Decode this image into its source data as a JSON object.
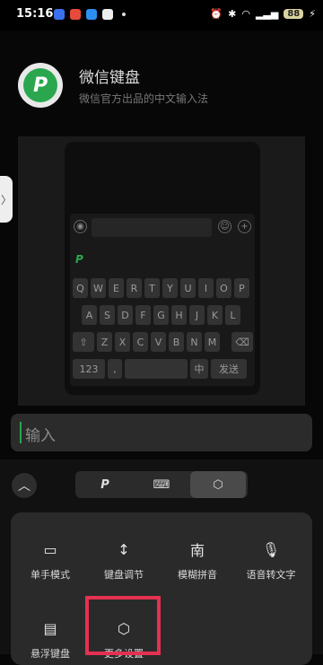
{
  "status": {
    "time": "15:16",
    "battery": "88"
  },
  "app": {
    "name": "微信键盘",
    "subtitle": "微信官方出品的中文输入法"
  },
  "preview": {
    "rows": [
      [
        "Q",
        "W",
        "E",
        "R",
        "T",
        "Y",
        "U",
        "I",
        "O",
        "P"
      ],
      [
        "A",
        "S",
        "D",
        "F",
        "G",
        "H",
        "J",
        "K",
        "L"
      ],
      [
        "Z",
        "X",
        "C",
        "V",
        "B",
        "N",
        "M"
      ]
    ],
    "num_key": "123",
    "comma_key": ",",
    "lang_key": "中",
    "send_key": "发送"
  },
  "input": {
    "placeholder": "输入"
  },
  "toolbar": {
    "tabs": [
      "logo-tab",
      "keyboard-tab",
      "settings-tab"
    ]
  },
  "settings_tiles": [
    {
      "label": "单手模式",
      "icon": "one-hand-icon"
    },
    {
      "label": "键盘调节",
      "icon": "resize-icon"
    },
    {
      "label": "模糊拼音",
      "icon": "fuzzy-pinyin-icon"
    },
    {
      "label": "语音转文字",
      "icon": "voice-to-text-icon"
    },
    {
      "label": "悬浮键盘",
      "icon": "floating-keyboard-icon"
    },
    {
      "label": "更多设置",
      "icon": "more-settings-icon"
    }
  ],
  "colors": {
    "accent": "#2aa74e",
    "highlight": "#e53151"
  }
}
